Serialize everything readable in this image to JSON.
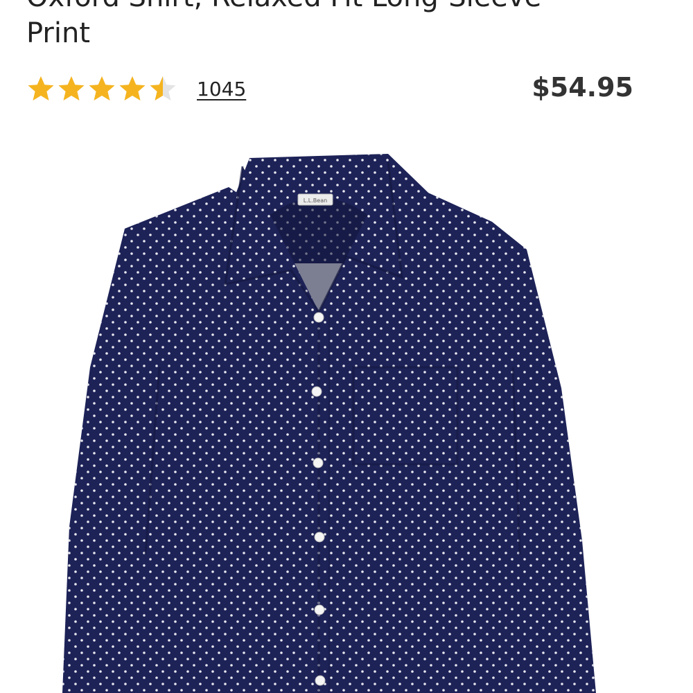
{
  "product": {
    "title": "Oxford Shirt, Relaxed Fit Long-Sleeve\nPrint",
    "rating": 4.5,
    "rating_max": 5,
    "review_count": "1045",
    "price": "$54.95",
    "image": {
      "label_text": "L.L.Bean",
      "shirt_color": "#1d2257",
      "dot_color": "#e8e8f0",
      "button_color": "#f4f4f4"
    },
    "star_color": "#f5b41f",
    "star_empty_color": "#e4e4e4"
  }
}
